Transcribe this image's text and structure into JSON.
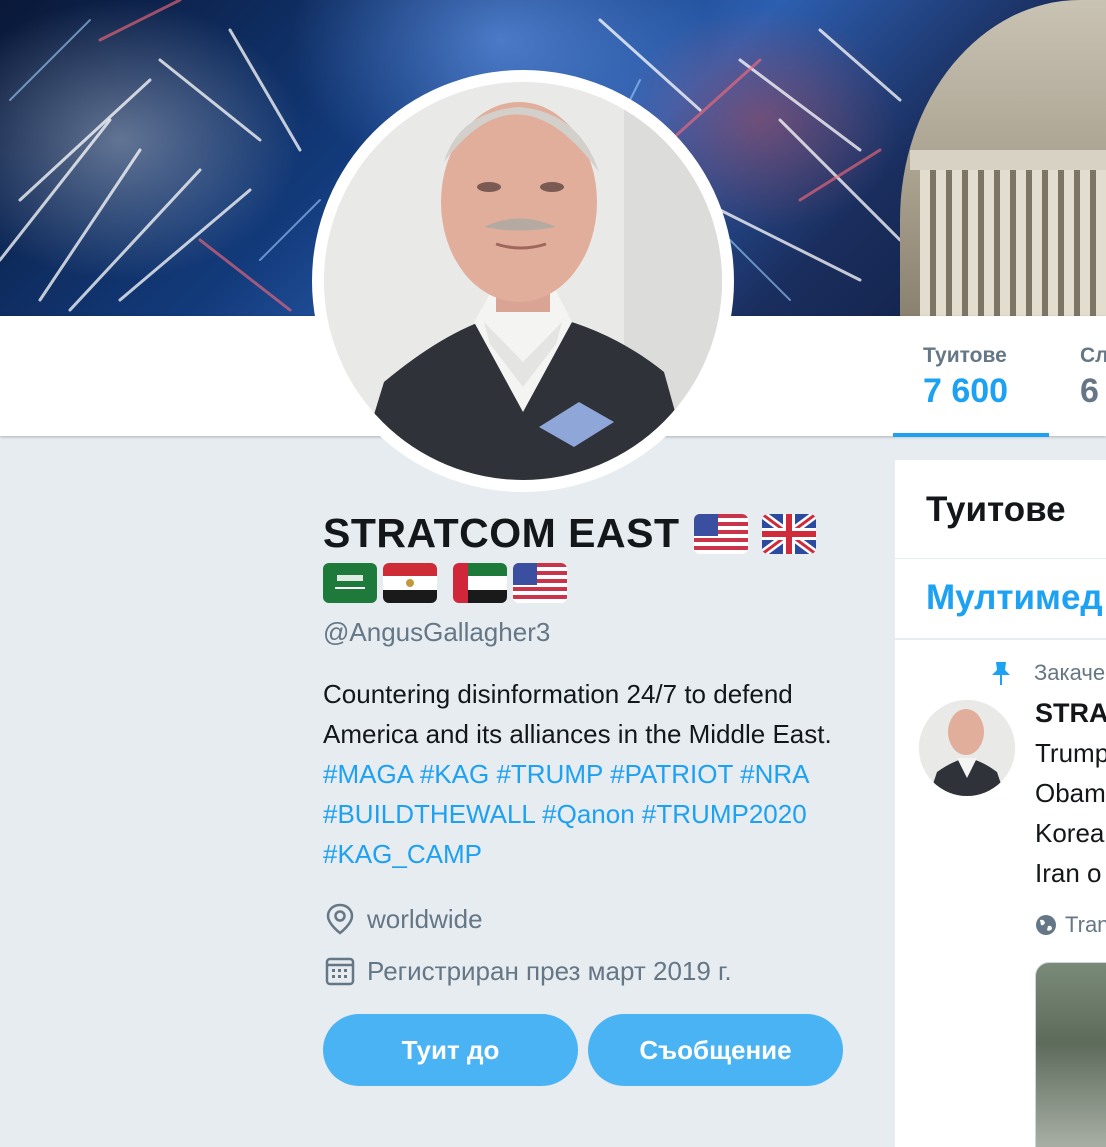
{
  "stats": [
    {
      "label": "Туитове",
      "value": "7 600",
      "active": true
    },
    {
      "label": "Сл",
      "value": "6",
      "active": false
    }
  ],
  "profile": {
    "name": "STRATCOM EAST",
    "handle": "@AngusGallagher3",
    "bio_text": "Countering disinformation 24/7 to defend America and its alliances in the Middle East.",
    "hashtags": [
      "#MAGA",
      "#KAG",
      "#TRUMP",
      "#PATRIOT",
      "#NRA",
      "#BUILDTHEWALL",
      "#Qanon",
      "#TRUMP2020",
      "#KAG_CAMP"
    ],
    "location": "worldwide",
    "joined": "Регистриран през март 2019 г.",
    "buttons": {
      "tweet_to": "Туит до",
      "message": "Съобщение"
    }
  },
  "timeline": {
    "heading": "Туитове",
    "media_tab": "Мултимед",
    "pinned_label": "Закаче",
    "tweet": {
      "author": "STRAT",
      "lines": [
        "Trump",
        "Obam",
        "Korea",
        "Iran o"
      ],
      "translate": "Tran"
    }
  },
  "icons": {
    "location": "location-pin-icon",
    "calendar": "calendar-icon",
    "pin": "pin-icon",
    "globe": "globe-icon"
  },
  "colors": {
    "accent": "#1da1f2",
    "button": "#4ab3f4",
    "muted": "#657786",
    "background": "#e6ecf0"
  }
}
